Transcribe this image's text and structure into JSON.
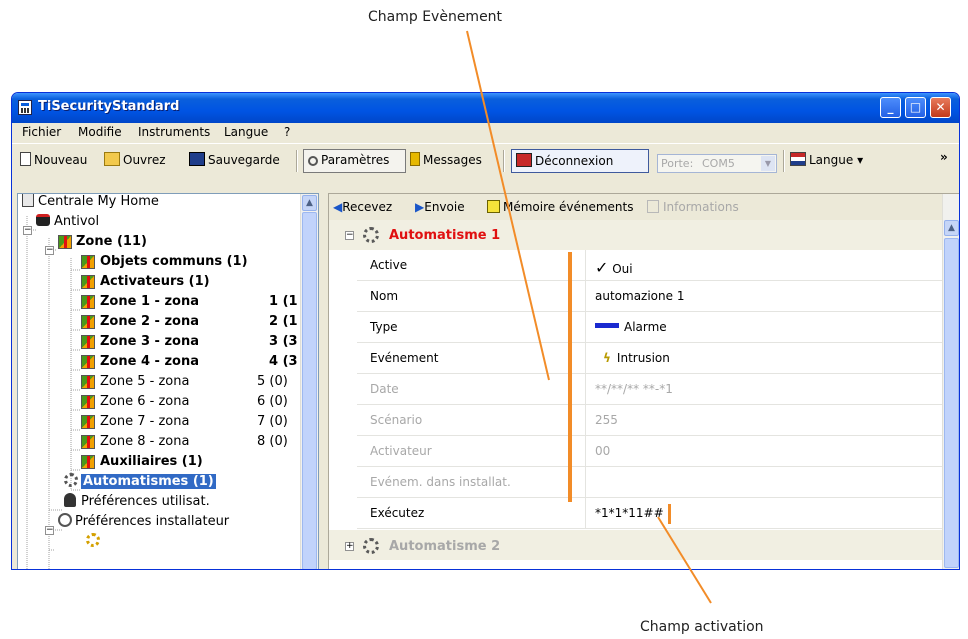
{
  "annotations": {
    "top": "Champ Evènement",
    "bottom": "Champ activation"
  },
  "window": {
    "title": "TiSecurityStandard",
    "buttons": {
      "minimize": "_",
      "maximize": "□",
      "close": "✕"
    }
  },
  "menu": [
    "Fichier",
    "Modifie",
    "Instruments",
    "Langue",
    "?"
  ],
  "toolbar": {
    "new": "Nouveau",
    "open": "Ouvrez",
    "save": "Sauvegarde",
    "params": "Paramètres",
    "messages": "Messages",
    "disconnect": "Déconnexion",
    "port_label": "Porte:",
    "port_value": "COM5",
    "language": "Langue",
    "overflow": "»"
  },
  "tree": {
    "root": "Centrale My Home",
    "antivol": "Antivol",
    "zone_group": "Zone (11)",
    "zones": [
      {
        "label": "Objets communs (1)",
        "count": "",
        "bold": true
      },
      {
        "label": "Activateurs (1)",
        "count": "",
        "bold": true
      },
      {
        "label": "Zone 1 - zona",
        "count": "1 (1",
        "bold": true
      },
      {
        "label": "Zone 2 - zona",
        "count": "2 (1",
        "bold": true
      },
      {
        "label": "Zone 3 - zona",
        "count": "3 (3",
        "bold": true
      },
      {
        "label": "Zone 4 - zona",
        "count": "4 (3",
        "bold": true
      },
      {
        "label": "Zone 5 - zona",
        "count": "5 (0)",
        "bold": false
      },
      {
        "label": "Zone 6 - zona",
        "count": "6 (0)",
        "bold": false
      },
      {
        "label": "Zone 7 - zona",
        "count": "7 (0)",
        "bold": false
      },
      {
        "label": "Zone 8 - zona",
        "count": "8 (0)",
        "bold": false
      },
      {
        "label": "Auxiliaires (1)",
        "count": "",
        "bold": true
      }
    ],
    "automatismes": "Automatismes (1)",
    "prefs_user": "Préférences utilisat.",
    "prefs_installer": "Préférences installateur"
  },
  "right_toolbar": {
    "receive": "Recevez",
    "send": "Envoie",
    "events": "Mémoire événements",
    "info": "Informations"
  },
  "automation1": {
    "title": "Automatisme 1",
    "rows": [
      {
        "label": "Active",
        "value": "Oui",
        "disabled": false
      },
      {
        "label": "Nom",
        "value": "automazione 1",
        "disabled": false
      },
      {
        "label": "Type",
        "value": "Alarme",
        "disabled": false
      },
      {
        "label": "Evénement",
        "value": "Intrusion",
        "disabled": false
      },
      {
        "label": "Date",
        "value": "**/**/** **-*1",
        "disabled": true
      },
      {
        "label": "Scénario",
        "value": "255",
        "disabled": true
      },
      {
        "label": "Activateur",
        "value": "00",
        "disabled": true
      },
      {
        "label": "Evénem. dans installat.",
        "value": "",
        "disabled": true
      },
      {
        "label": "Exécutez",
        "value": "*1*1*11##",
        "disabled": false
      }
    ]
  },
  "automation2": {
    "title": "Automatisme 2"
  },
  "colors": {
    "accent_red": "#e01010",
    "annotation_orange": "#f28c28",
    "selection": "#316ac5"
  }
}
